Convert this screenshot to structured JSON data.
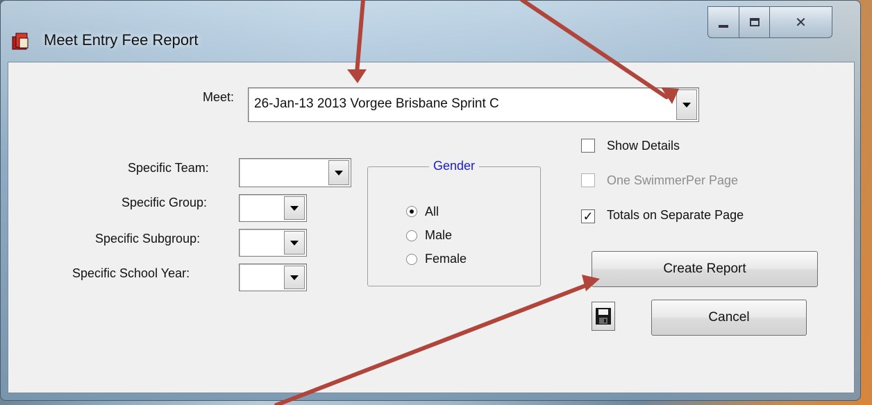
{
  "window": {
    "title": "Meet Entry Fee Report",
    "caption_buttons": {
      "minimize": "minimize-icon",
      "maximize": "maximize-icon",
      "close": "close-icon"
    }
  },
  "meet": {
    "label": "Meet:",
    "selected": "26-Jan-13 2013 Vorgee Brisbane Sprint C"
  },
  "filters": [
    {
      "label": "Specific Team:",
      "value": ""
    },
    {
      "label": "Specific Group:",
      "value": ""
    },
    {
      "label": "Specific Subgroup:",
      "value": ""
    },
    {
      "label": "Specific  School Year:",
      "value": ""
    }
  ],
  "gender": {
    "title": "Gender",
    "options": [
      "All",
      "Male",
      "Female"
    ],
    "selected": "All",
    "title_color": "#1a1ad6"
  },
  "options": {
    "show_details": {
      "label": "Show Details",
      "checked": false
    },
    "one_swimmer_per_page": {
      "label": "One SwimmerPer Page",
      "checked": false,
      "disabled": true
    },
    "totals_separate_page": {
      "label": "Totals on Separate Page",
      "checked": true
    }
  },
  "buttons": {
    "create_report": "Create Report",
    "cancel": "Cancel",
    "save_icon": "save-disk-icon"
  },
  "annotation": {
    "arrow_color": "#b0453c"
  }
}
